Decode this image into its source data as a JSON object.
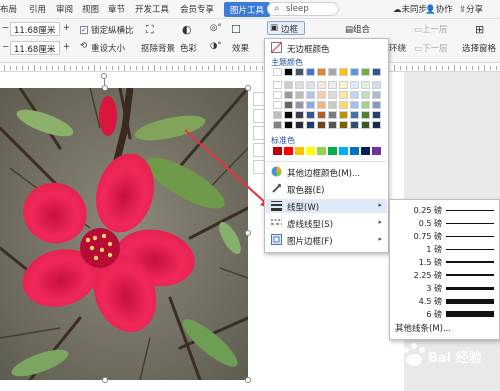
{
  "ribbon_tabs": {
    "items": [
      "布局",
      "引用",
      "审阅",
      "视图",
      "章节",
      "开发工具",
      "会员专享"
    ],
    "active": "图片工具"
  },
  "search": {
    "placeholder": "sleep"
  },
  "top_right": {
    "sync": "未同步",
    "collab": "协作",
    "share": "分享"
  },
  "ribbon": {
    "height_value": "11.68厘米",
    "width_value": "11.68厘米",
    "lock_ratio": "锁定纵横比",
    "reset_size": "重设大小",
    "crop": "抠除背景",
    "color": "色彩",
    "effects": "效果",
    "border_btn": "边框",
    "combine": "组合",
    "wrap": "环绕",
    "prev_layer": "上一层",
    "next_layer": "下一层",
    "select_pane": "选择窗格"
  },
  "border_menu": {
    "no_border": "无边框颜色",
    "theme_colors_title": "主题颜色",
    "standard_colors_title": "标准色",
    "more_colors": "其他边框颜色(M)...",
    "eyedropper": "取色器(E)",
    "line_weight": "线型(W)",
    "dash_type": "虚线线型(S)",
    "picture_border": "图片边框(F)",
    "theme_top_row": [
      "#ffffff",
      "#000000",
      "#44546a",
      "#4472c4",
      "#ed7d31",
      "#a5a5a5",
      "#ffc000",
      "#5b9bd5",
      "#70ad47",
      "#2f5597"
    ],
    "standard_colors": [
      "#c00000",
      "#ff0000",
      "#ffc000",
      "#ffff00",
      "#92d050",
      "#00b050",
      "#00b0f0",
      "#0070c0",
      "#002060",
      "#7030a0"
    ]
  },
  "line_weight_menu": {
    "items": [
      {
        "label": "0.25 磅",
        "pt": 0.25
      },
      {
        "label": "0.5 磅",
        "pt": 0.5
      },
      {
        "label": "0.75 磅",
        "pt": 0.75
      },
      {
        "label": "1 磅",
        "pt": 1
      },
      {
        "label": "1.5 磅",
        "pt": 1.5
      },
      {
        "label": "2.25 磅",
        "pt": 2.25
      },
      {
        "label": "3 磅",
        "pt": 3
      },
      {
        "label": "4.5 磅",
        "pt": 4.5
      },
      {
        "label": "6 磅",
        "pt": 6
      }
    ],
    "more": "其他线条(M)..."
  },
  "watermark": "Bai经验"
}
